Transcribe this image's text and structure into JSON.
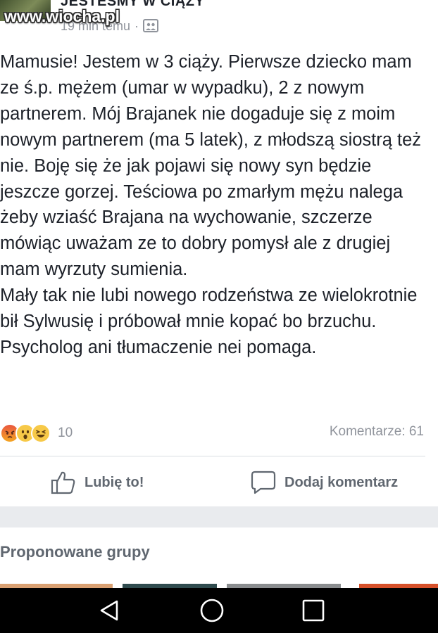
{
  "header": {
    "group_name": "JESTEŚMY W CIĄŻY",
    "time_ago": "19 min temu",
    "separator": "·",
    "privacy_icon": "photo-group-icon"
  },
  "watermark": {
    "text": "www.wiocha.pl"
  },
  "post": {
    "paragraph_1": "Mamusie! Jestem w 3 ciąży. Pierwsze dziecko mam ze ś.p. mężem (umar w wypadku), 2 z nowym partnerem. Mój Brajanek nie dogaduje się z moim nowym partnerem (ma 5 latek), z młodszą siostrą też nie. Boję się że jak pojawi się nowy syn będzie jeszcze gorzej. Teściowa po zmarłym mężu nalega żeby wziaść Brajana na wychowanie, szczerze mówiąc uważam ze to dobry pomysł ale z drugiej mam wyrzuty sumienia.",
    "paragraph_2": "Mały tak nie lubi nowego rodzeństwa ze wielokrotnie bił Sylwusię i próbował mnie kopać bo brzuchu. Psycholog ani tłumaczenie nei pomaga."
  },
  "reactions": {
    "icons": [
      "angry-reaction-icon",
      "wow-reaction-icon",
      "haha-reaction-icon"
    ],
    "count": "10",
    "comments": "Komentarze: 61"
  },
  "actions": {
    "like_label": "Lubię to!",
    "comment_label": "Dodaj komentarz"
  },
  "suggested": {
    "title": "Proponowane grupy"
  },
  "colors": {
    "text": "#1d2129",
    "muted": "#90949c",
    "action": "#606770",
    "band": "#e9ebee"
  },
  "navbar": {
    "icons": [
      "back-icon",
      "home-icon",
      "recents-icon"
    ]
  }
}
